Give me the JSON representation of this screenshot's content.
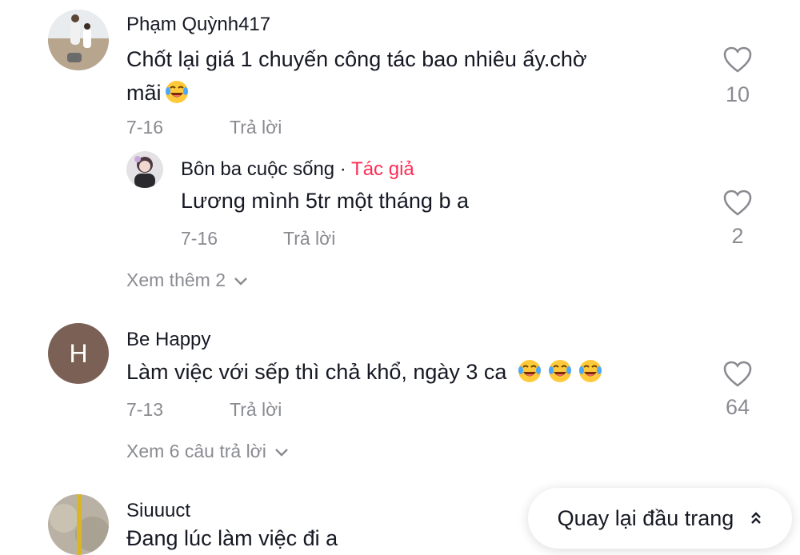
{
  "comments": [
    {
      "user": "Phạm Quỳnh417",
      "text": "Chốt lại giá 1 chuyến công tác bao nhiêu ấy.chờ",
      "text_line2": "mãi",
      "emoji": "laughing-tears-emoji",
      "date": "7-16",
      "reply_label": "Trả lời",
      "likes": "10",
      "replies": [
        {
          "user": "Bôn ba cuộc sống",
          "separator": " · ",
          "author_badge": "Tác giả",
          "text": "Lương mình 5tr một tháng b a",
          "date": "7-16",
          "reply_label": "Trả lời",
          "likes": "2"
        }
      ],
      "view_more": "Xem thêm 2"
    },
    {
      "user": "Be Happy",
      "avatar_letter": "H",
      "avatar_color": "#7b6155",
      "text": "Làm việc với sếp thì chả khổ, ngày 3 ca",
      "emoji_count": 3,
      "date": "7-13",
      "reply_label": "Trả lời",
      "likes": "64",
      "view_more": "Xem 6 câu trả lời"
    },
    {
      "user": "Siuuuct",
      "text": "Đang lúc làm việc đi a"
    }
  ],
  "back_to_top": {
    "label": "Quay lại đầu trang",
    "icon": "double-chevron-up-icon"
  },
  "colors": {
    "text": "#161823",
    "muted": "#8a8b91",
    "author": "#fe2c55"
  }
}
